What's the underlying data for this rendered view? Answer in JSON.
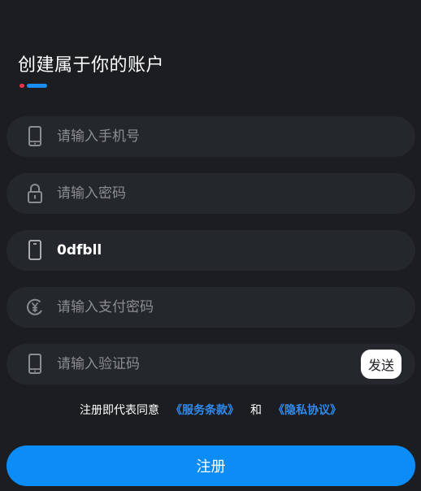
{
  "page": {
    "title": "创建属于你的账户"
  },
  "colors": {
    "background": "#1b1d21",
    "field_background": "#24272c",
    "accent_red": "#e8354b",
    "accent_blue": "#1a8cf2",
    "link_blue": "#2f8bf0",
    "button_blue": "#0b8cf7"
  },
  "form": {
    "phone": {
      "icon": "mobile-phone-icon",
      "placeholder": "请输入手机号",
      "value": ""
    },
    "password": {
      "icon": "lock-icon",
      "placeholder": "请输入密码",
      "value": ""
    },
    "third": {
      "icon": "phone-outline-icon",
      "placeholder": "",
      "value": "0dfbll"
    },
    "pay_password": {
      "icon": "yen-coin-icon",
      "placeholder": "请输入支付密码",
      "value": ""
    },
    "verification": {
      "icon": "mobile-phone-icon",
      "placeholder": "请输入验证码",
      "value": "",
      "send_label": "发送"
    }
  },
  "agreement": {
    "prefix": "注册即代表同意",
    "terms_link": "《服务条款》",
    "conjunction": "和",
    "privacy_link": "《隐私协议》"
  },
  "register_label": "注册"
}
